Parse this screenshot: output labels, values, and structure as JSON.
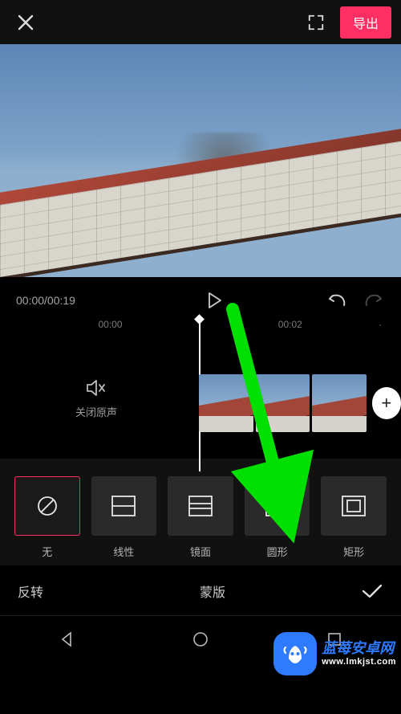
{
  "topbar": {
    "export_label": "导出"
  },
  "playback": {
    "time_display": "00:00/00:19"
  },
  "ruler": {
    "t0": "00:00",
    "t1": "00:02"
  },
  "mute": {
    "label": "关闭原声"
  },
  "masks": {
    "items": [
      {
        "id": "none",
        "label": "无",
        "selected": true
      },
      {
        "id": "linear",
        "label": "线性",
        "selected": false
      },
      {
        "id": "mirror",
        "label": "镜面",
        "selected": false
      },
      {
        "id": "circle",
        "label": "圆形",
        "selected": false
      },
      {
        "id": "rect",
        "label": "矩形",
        "selected": false
      }
    ]
  },
  "bottom": {
    "invert_label": "反转",
    "panel_title": "蒙版"
  },
  "colors": {
    "accent": "#ff2e63",
    "arrow": "#00e000",
    "brand": "#2f7bff"
  },
  "watermark": {
    "line1": "蓝苺安卓网",
    "line2": "www.lmkjst.com"
  }
}
